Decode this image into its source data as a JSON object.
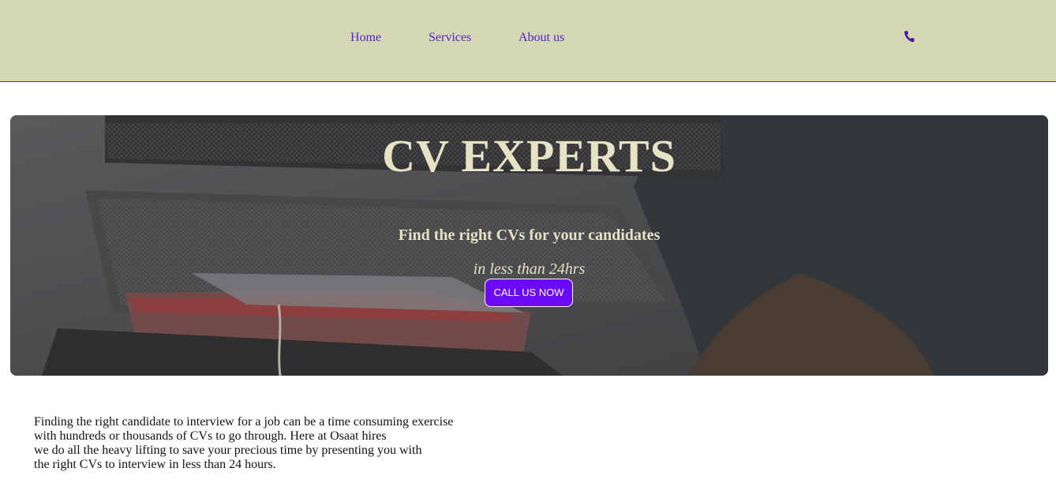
{
  "nav": {
    "items": [
      {
        "label": "Home"
      },
      {
        "label": "Services"
      },
      {
        "label": "About us"
      }
    ],
    "phone_icon": "phone-icon"
  },
  "hero": {
    "title": "CV EXPERTS",
    "subtitle": "Find the right CVs for your candidates",
    "tagline": "in less than 24hrs",
    "cta_label": "CALL US NOW"
  },
  "intro": {
    "lines": [
      "Finding the right candidate to interview for a job can be a time consuming exercise",
      "with hundreds or thousands of CVs to go through. Here at Osaat hires",
      "we do all the heavy lifting to save your precious time by presenting you with",
      "the right CVs to interview in less than 24 hours."
    ]
  },
  "colors": {
    "navbar_bg": "#d3d7b3",
    "link": "#5b1fd1",
    "hero_text": "#e6e2c6",
    "cta_bg": "#6a0af7"
  }
}
